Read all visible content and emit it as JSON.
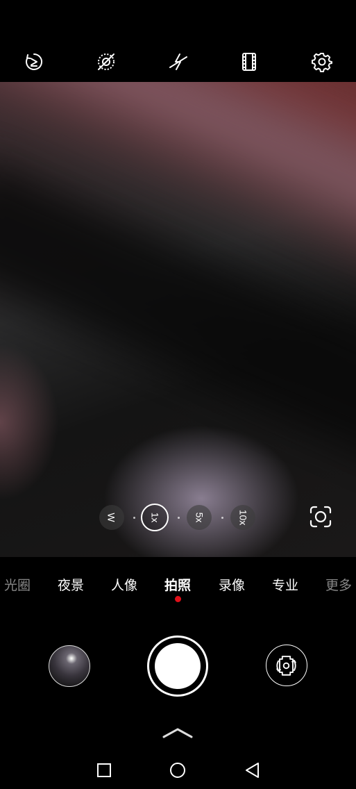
{
  "top_toolbar": {
    "icons": [
      "live-photo-icon",
      "ai-off-icon",
      "flash-off-icon",
      "aspect-ratio-icon",
      "settings-icon"
    ]
  },
  "zoom": {
    "levels": [
      "W",
      "1x",
      "5x",
      "10x"
    ],
    "selected": "1x"
  },
  "lens_switch_icon": "camera-switch-lens-icon",
  "modes": {
    "items": [
      "光圈",
      "夜景",
      "人像",
      "拍照",
      "录像",
      "专业",
      "更多"
    ],
    "selected": "拍照"
  },
  "colors": {
    "background": "#000000",
    "mode_indicator": "#e0101a",
    "text": "#ffffff",
    "faded_text": "#888888"
  },
  "bottom_controls": {
    "gallery_icon": "gallery-thumbnail",
    "shutter_icon": "shutter-button",
    "flip_icon": "flip-camera-icon",
    "expand_icon": "chevron-up-icon"
  },
  "nav_bar": {
    "icons": [
      "recents-square-icon",
      "home-circle-icon",
      "back-triangle-icon"
    ]
  }
}
